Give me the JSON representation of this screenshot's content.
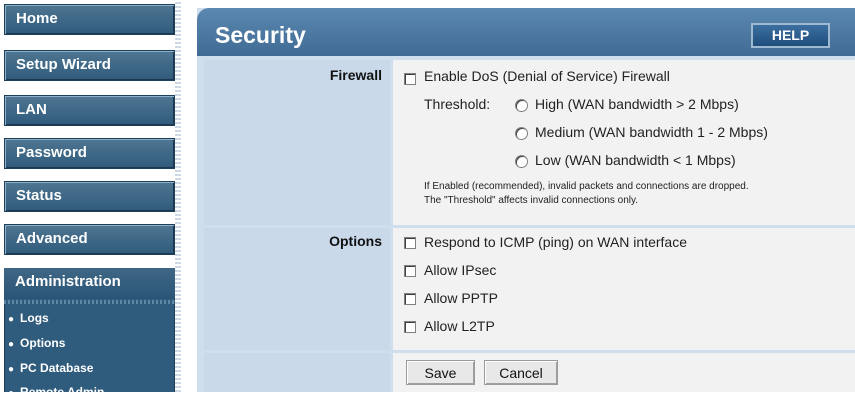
{
  "sidebar": {
    "items": [
      {
        "label": "Home"
      },
      {
        "label": "Setup Wizard"
      },
      {
        "label": "LAN"
      },
      {
        "label": "Password"
      },
      {
        "label": "Status"
      },
      {
        "label": "Advanced"
      },
      {
        "label": "Administration"
      }
    ],
    "sub_items": [
      {
        "label": "Logs"
      },
      {
        "label": "Options"
      },
      {
        "label": "PC Database"
      },
      {
        "label": "Remote Admin"
      }
    ]
  },
  "page": {
    "title": "Security",
    "help_label": "HELP"
  },
  "firewall": {
    "section_label": "Firewall",
    "enable_label": "Enable DoS (Denial of Service) Firewall",
    "threshold_label": "Threshold:",
    "options": [
      {
        "label": "High (WAN bandwidth > 2 Mbps)"
      },
      {
        "label": "Medium (WAN bandwidth 1 - 2 Mbps)"
      },
      {
        "label": "Low (WAN bandwidth < 1 Mbps)"
      }
    ],
    "note_line1": "If Enabled (recommended), invalid packets and connections are dropped.",
    "note_line2": "The \"Threshold\" affects invalid connections only."
  },
  "options": {
    "section_label": "Options",
    "items": [
      {
        "label": "Respond to ICMP (ping) on WAN interface"
      },
      {
        "label": "Allow IPsec"
      },
      {
        "label": "Allow PPTP"
      },
      {
        "label": "Allow L2TP"
      }
    ]
  },
  "actions": {
    "save_label": "Save",
    "cancel_label": "Cancel"
  }
}
